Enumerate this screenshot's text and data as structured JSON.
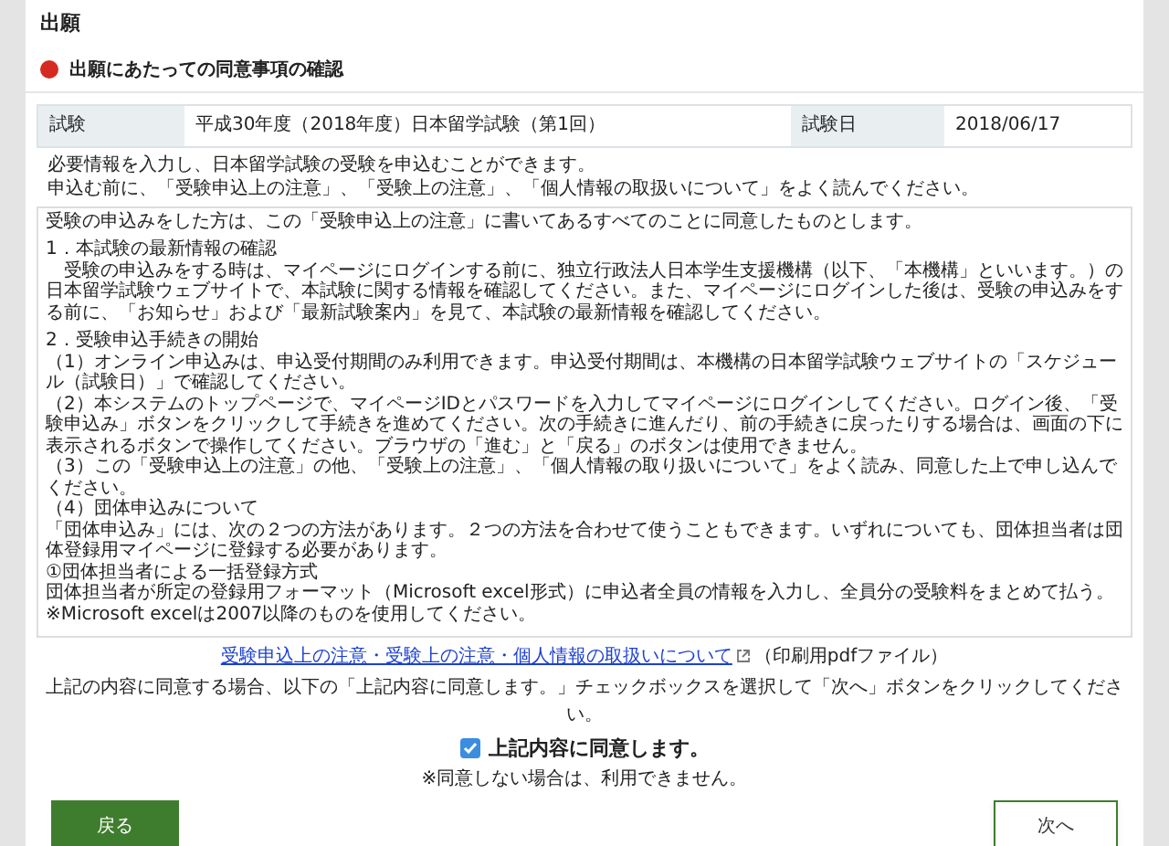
{
  "page_title": "出願",
  "section": {
    "title": "出願にあたっての同意事項の確認"
  },
  "exam_table": {
    "exam_label": "試験",
    "exam_value": "平成30年度（2018年度）日本留学試験（第1回）",
    "date_label": "試験日",
    "date_value": "2018/06/17"
  },
  "intro": [
    "必要情報を入力し、日本留学試験の受験を申込むことができます。",
    "申込む前に、「受験申込上の注意」、「受験上の注意」、「個人情報の取扱いについて」をよく読んでください。"
  ],
  "notice": {
    "lead": "受験の申込みをした方は、この「受験申込上の注意」に書いてあるすべてのことに同意したものとします。",
    "sections": [
      {
        "heading": "1．本試験の最新情報の確認",
        "paragraphs": [
          "　受験の申込みをする時は、マイページにログインする前に、独立行政法人日本学生支援機構（以下、「本機構」といいます。）の日本留学試験ウェブサイトで、本試験に関する情報を確認してください。また、マイページにログインした後は、受験の申込みをする前に、「お知らせ」および「最新試験案内」を見て、本試験の最新情報を確認してください。"
        ]
      },
      {
        "heading": "2．受験申込手続きの開始",
        "paragraphs": [
          "（1）オンライン申込みは、申込受付期間のみ利用できます。申込受付期間は、本機構の日本留学試験ウェブサイトの「スケジュール（試験日）」で確認してください。",
          "（2）本システムのトップページで、マイページIDとパスワードを入力してマイページにログインしてください。ログイン後、「受験申込み」ボタンをクリックして手続きを進めてください。次の手続きに進んだり、前の手続きに戻ったりする場合は、画面の下に表示されるボタンで操作してください。ブラウザの「進む」と「戻る」のボタンは使用できません。",
          "（3）この「受験申込上の注意」の他、「受験上の注意」、「個人情報の取り扱いについて」をよく読み、同意した上で申し込んでください。",
          "（4）団体申込みについて",
          "「団体申込み」には、次の２つの方法があります。２つの方法を合わせて使うこともできます。いずれについても、団体担当者は団体登録用マイページに登録する必要があります。",
          "①団体担当者による一括登録方式",
          "団体担当者が所定の登録用フォーマット（Microsoft excel形式）に申込者全員の情報を入力し、全員分の受験料をまとめて払う。",
          "※Microsoft excelは2007以降のものを使用してください。"
        ]
      }
    ]
  },
  "pdf_link": {
    "label": "受験申込上の注意・受験上の注意・個人情報の取扱いについて",
    "note": "（印刷用pdfファイル）"
  },
  "instruction": "上記の内容に同意する場合、以下の「上記内容に同意します。」チェックボックスを選択して「次へ」ボタンをクリックしてください。",
  "agree": {
    "label": "上記内容に同意します。",
    "checked": true
  },
  "agree_note": "※同意しない場合は、利用できません。",
  "buttons": [
    {
      "label": "戻る",
      "kind": "back"
    },
    {
      "label": "次へ",
      "kind": "next"
    }
  ]
}
